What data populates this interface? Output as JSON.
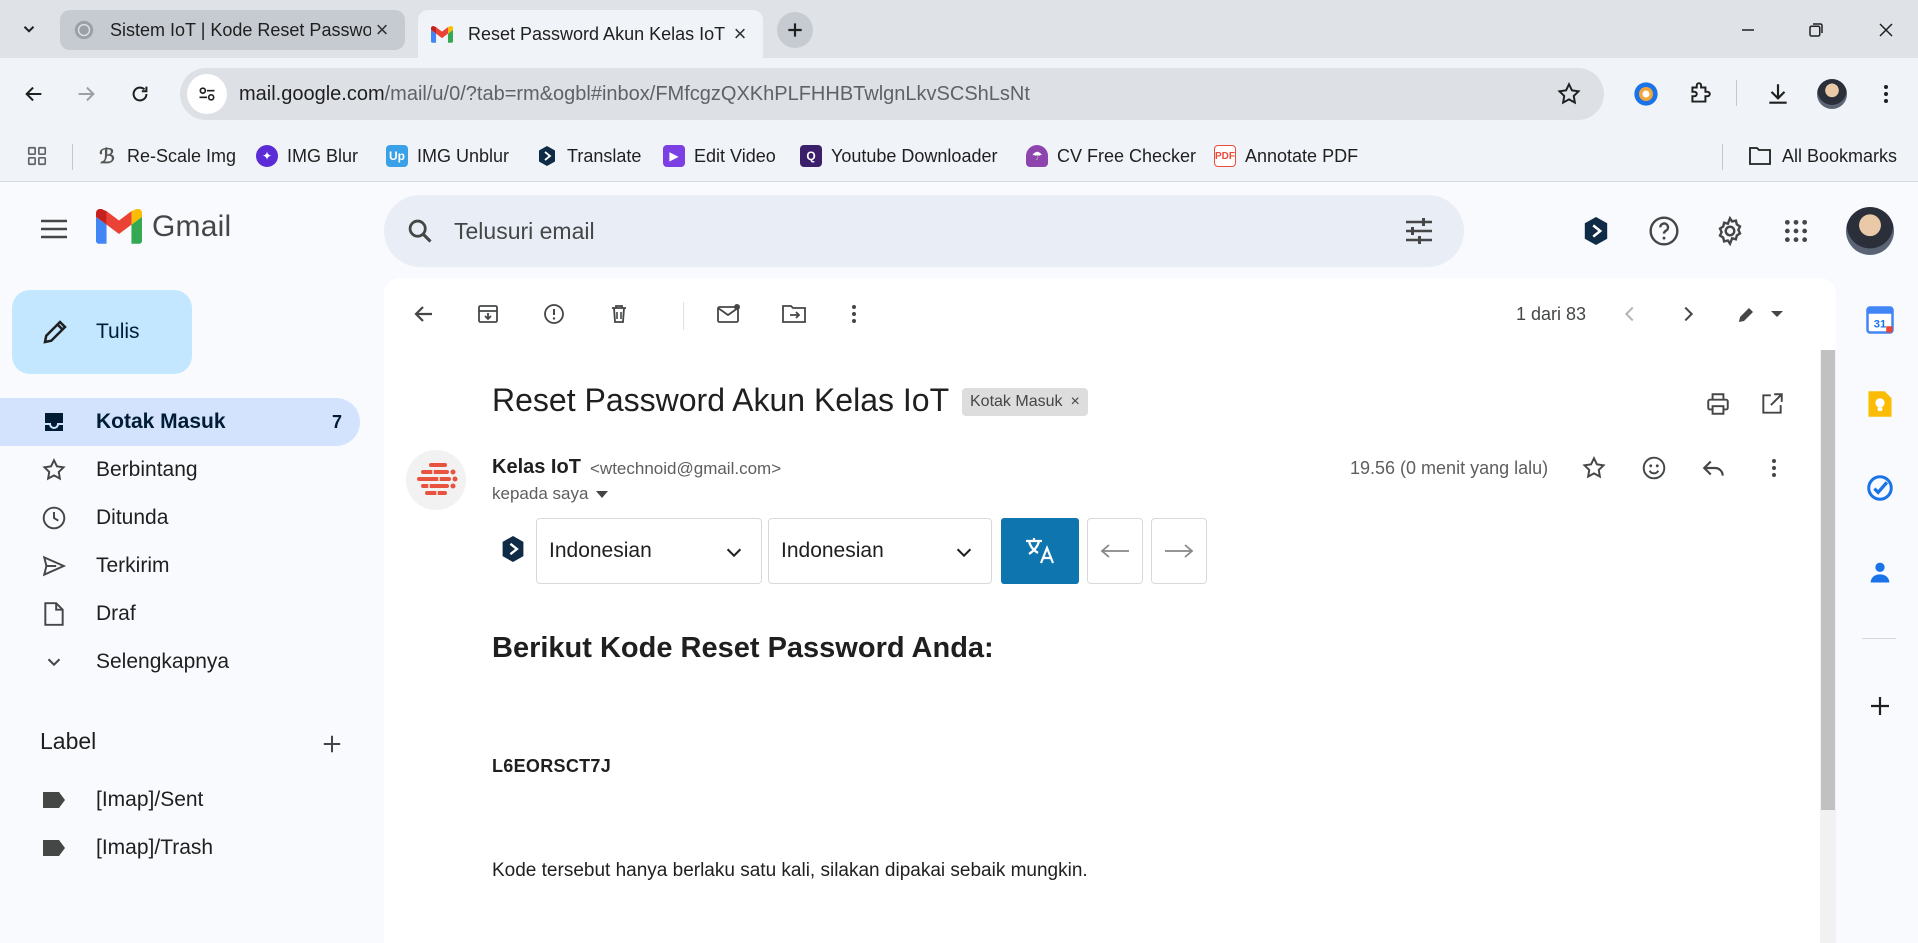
{
  "browser": {
    "tabs": [
      {
        "title": "Sistem IoT | Kode Reset Passwo",
        "active": false
      },
      {
        "title": "Reset Password Akun Kelas IoT",
        "active": true
      }
    ],
    "url_host": "mail.google.com",
    "url_path": "/mail/u/0/?tab=rm&ogbl#inbox/FMfcgzQXKhPLFHHBTwlgnLkvSCShLsNt",
    "bookmarks": [
      {
        "label": "Re-Scale Img",
        "icon": "rescale-icon",
        "color": "#555555"
      },
      {
        "label": "IMG Blur",
        "icon": "img-blur-icon",
        "color": "#5b2bd6"
      },
      {
        "label": "IMG Unblur",
        "icon": "img-unblur-icon",
        "color": "#3aa0e8"
      },
      {
        "label": "Translate",
        "icon": "translate-bookmark-icon",
        "color": "#0f2b46"
      },
      {
        "label": "Edit Video",
        "icon": "edit-video-icon",
        "color": "#7b3fe4"
      },
      {
        "label": "Youtube Downloader",
        "icon": "youtube-downloader-icon",
        "color": "#3b1f6b"
      },
      {
        "label": "CV Free Checker",
        "icon": "cv-checker-icon",
        "color": "#8e44ad"
      },
      {
        "label": "Annotate PDF",
        "icon": "annotate-pdf-icon",
        "color": "#e74c3c"
      }
    ],
    "all_bookmarks": "All Bookmarks"
  },
  "gmail": {
    "logo_text": "Gmail",
    "search_placeholder": "Telusuri email",
    "compose_label": "Tulis",
    "nav": [
      {
        "label": "Kotak Masuk",
        "count": "7",
        "icon": "inbox-icon",
        "active": true
      },
      {
        "label": "Berbintang",
        "count": "",
        "icon": "star-icon",
        "active": false
      },
      {
        "label": "Ditunda",
        "count": "",
        "icon": "clock-icon",
        "active": false
      },
      {
        "label": "Terkirim",
        "count": "",
        "icon": "send-icon",
        "active": false
      },
      {
        "label": "Draf",
        "count": "",
        "icon": "draft-icon",
        "active": false
      },
      {
        "label": "Selengkapnya",
        "count": "",
        "icon": "chevron-down-icon",
        "active": false
      }
    ],
    "labels_header": "Label",
    "labels": [
      {
        "label": "[Imap]/Sent"
      },
      {
        "label": "[Imap]/Trash"
      }
    ]
  },
  "message": {
    "count_text": "1 dari 83",
    "subject": "Reset Password Akun Kelas IoT",
    "label_chip": "Kotak Masuk",
    "sender_name": "Kelas IoT",
    "sender_email": "<wtechnoid@gmail.com>",
    "to_text": "kepada saya",
    "time": "19.56 (0 menit yang lalu)",
    "translate_from": "Indonesian",
    "translate_to": "Indonesian",
    "heading": "Berikut Kode Reset Password Anda:",
    "code": "L6EORSCT7J",
    "body": "Kode tersebut hanya berlaku satu kali, silakan dipakai sebaik mungkin."
  },
  "colors": {
    "accent": "#0b57d0",
    "nav_active_bg": "#d3e3fd",
    "compose_bg": "#c2e7ff",
    "translate_btn": "#0f75af"
  }
}
